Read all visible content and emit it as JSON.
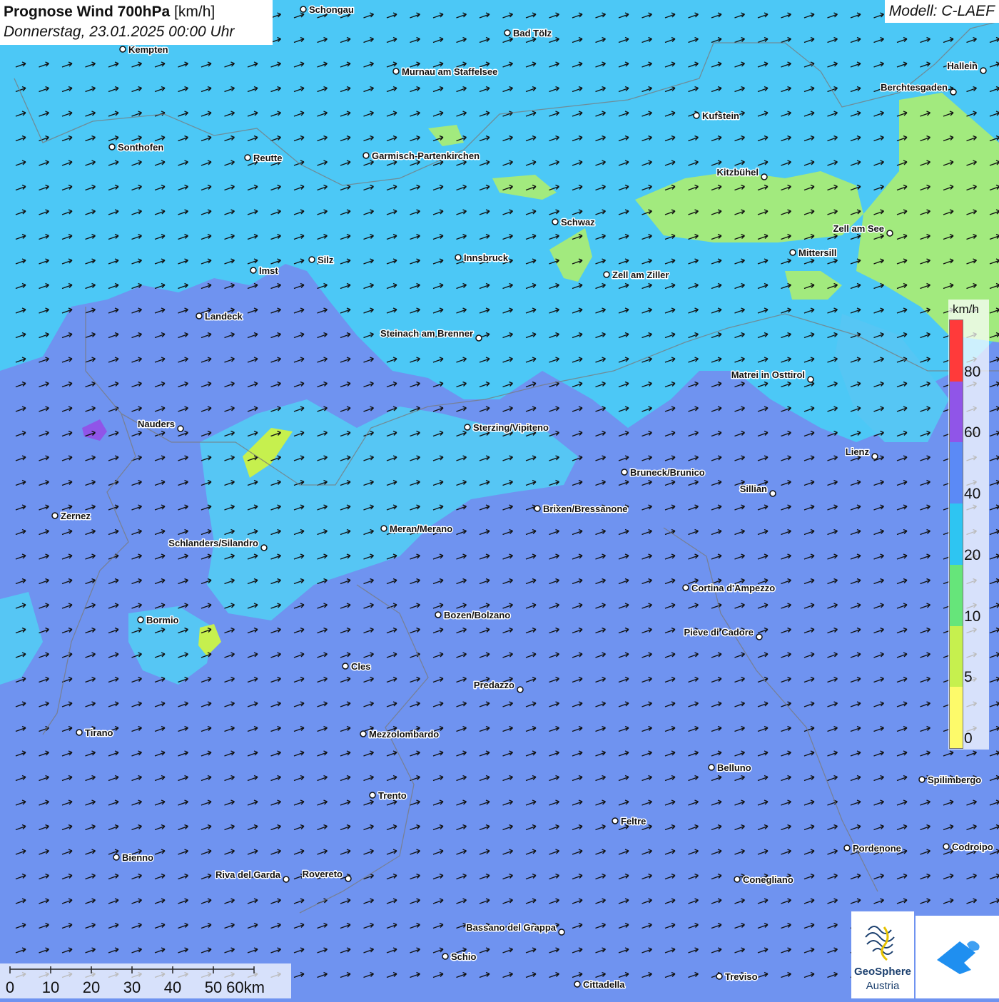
{
  "header": {
    "title_bold": "Prognose Wind 700hPa",
    "title_unit": "[km/h]",
    "subtitle": "Donnerstag, 23.01.2025 00:00 Uhr",
    "model": "Modell: C-LAEF"
  },
  "legend": {
    "unit": "km/h",
    "ticks": [
      "80",
      "60",
      "40",
      "20",
      "10",
      "5",
      "0"
    ],
    "colors": [
      "#ff3a3a",
      "#9055e8",
      "#5b8af6",
      "#2ec5f2",
      "#66e57a",
      "#c6f04e",
      "#fdfa6a"
    ]
  },
  "scale": {
    "labels": [
      "0",
      "10",
      "20",
      "30",
      "40",
      "50",
      "60km"
    ]
  },
  "cities": [
    {
      "name": "Schongau"
    },
    {
      "name": "Bad Tölz"
    },
    {
      "name": "Kempten"
    },
    {
      "name": "Murnau am Staffelsee"
    },
    {
      "name": "Hallein"
    },
    {
      "name": "Berchtesgaden"
    },
    {
      "name": "Kufstein"
    },
    {
      "name": "Sonthofen"
    },
    {
      "name": "Reutte"
    },
    {
      "name": "Garmisch-Partenkirchen"
    },
    {
      "name": "Kitzbühel"
    },
    {
      "name": "Schwaz"
    },
    {
      "name": "Zell am See"
    },
    {
      "name": "Mittersill"
    },
    {
      "name": "Silz"
    },
    {
      "name": "Innsbruck"
    },
    {
      "name": "Imst"
    },
    {
      "name": "Zell am Ziller"
    },
    {
      "name": "Landeck"
    },
    {
      "name": "Steinach am Brenner"
    },
    {
      "name": "Matrei in Osttirol"
    },
    {
      "name": "Nauders"
    },
    {
      "name": "Sterzing/Vipiteno"
    },
    {
      "name": "Lienz"
    },
    {
      "name": "Bruneck/Brunico"
    },
    {
      "name": "Sillian"
    },
    {
      "name": "Brixen/Bressanone"
    },
    {
      "name": "Zernez"
    },
    {
      "name": "Meran/Merano"
    },
    {
      "name": "Schlanders/Silandro"
    },
    {
      "name": "Cortina d'Ampezzo"
    },
    {
      "name": "Bozen/Bolzano"
    },
    {
      "name": "Bormio"
    },
    {
      "name": "Pieve di Cadore"
    },
    {
      "name": "Cles"
    },
    {
      "name": "Predazzo"
    },
    {
      "name": "Tirano"
    },
    {
      "name": "Mezzolombardo"
    },
    {
      "name": "Belluno"
    },
    {
      "name": "Spilimbergo"
    },
    {
      "name": "Trento"
    },
    {
      "name": "Feltre"
    },
    {
      "name": "Pordenone"
    },
    {
      "name": "Codroipo"
    },
    {
      "name": "Bienno"
    },
    {
      "name": "Riva del Garda"
    },
    {
      "name": "Rovereto"
    },
    {
      "name": "Conegliano"
    },
    {
      "name": "Bassano del Grappa"
    },
    {
      "name": "Schio"
    },
    {
      "name": "Treviso"
    },
    {
      "name": "Cittadella"
    }
  ],
  "wind_vectors": {
    "direction": "from west-southwest",
    "arrow_icon": "wind-arrow-icon"
  },
  "logos": {
    "geosphere_line1": "GeoSphere",
    "geosphere_line2": "Austria"
  },
  "colors": {
    "base_map": "#6f93f0",
    "band_20_40": "#4cc8f6",
    "band_10_20": "#a2ea7e",
    "band_60_80": "#9055e8"
  }
}
